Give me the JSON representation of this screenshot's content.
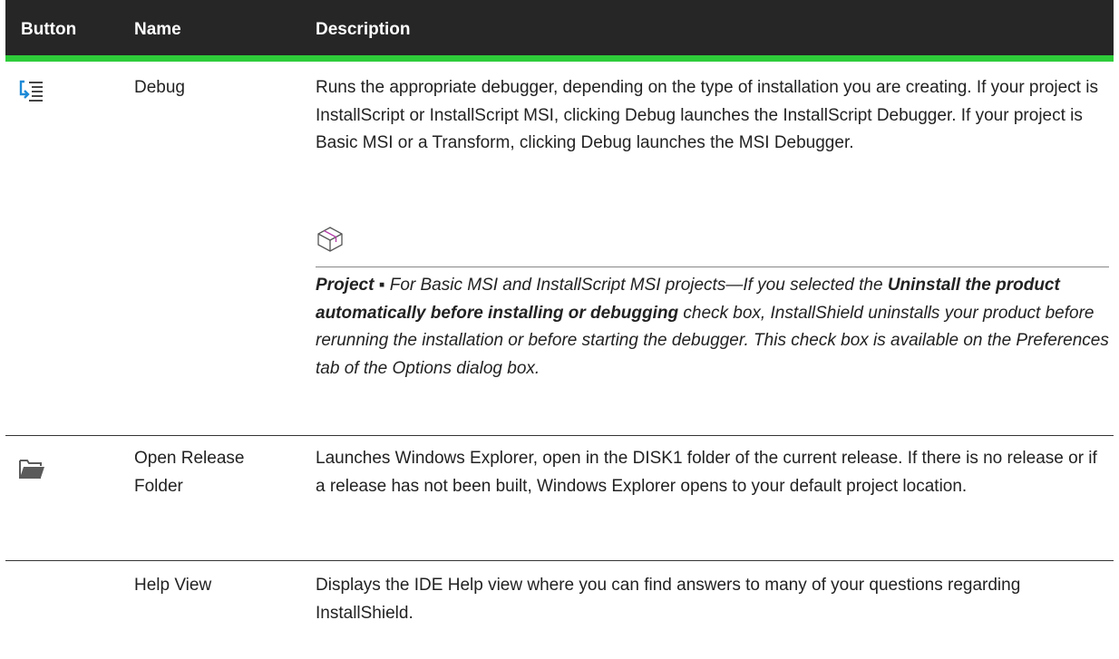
{
  "table": {
    "headers": {
      "button": "Button",
      "name": "Name",
      "description": "Description"
    },
    "rows": [
      {
        "icon": "debug-icon",
        "name": "Debug",
        "description": "Runs the appropriate debugger, depending on the type of installation you are creating. If your project is InstallScript or InstallScript MSI, clicking Debug launches the InstallScript Debugger. If your project is Basic MSI or a Transform, clicking Debug launches the MSI Debugger.",
        "note": {
          "icon": "project-package-icon",
          "label": "Project",
          "separator": " ▪ ",
          "text_1": "For Basic MSI and InstallScript MSI projects—If you selected the ",
          "bold_text": "Uninstall the product automatically before installing or debugging",
          "text_2": " check box, InstallShield uninstalls your product before rerunning the installation or before starting the debugger. This check box is available on the Preferences tab of the Options dialog box."
        }
      },
      {
        "icon": "folder-icon",
        "name": "Open Release Folder",
        "description": "Launches Windows Explorer, open in the DISK1 folder of the current release. If there is no release or if a release has not been built, Windows Explorer opens to your default project location."
      },
      {
        "icon": "",
        "name": "Help View",
        "description": "Displays the IDE Help view where you can find answers to many of your questions regarding InstallShield."
      }
    ]
  },
  "colors": {
    "header_bg": "#262626",
    "header_rule": "#2ecc3a",
    "icon_blue": "#1e8ad6",
    "folder_gray": "#5a5a5a"
  }
}
